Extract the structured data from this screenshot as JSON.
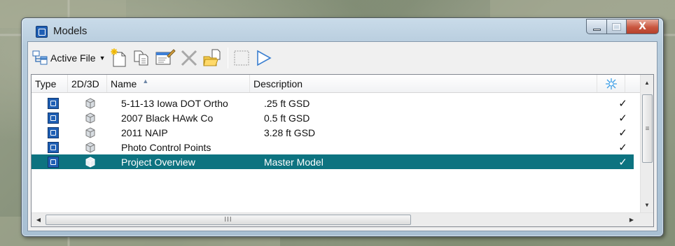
{
  "window": {
    "title": "Models"
  },
  "toolbar": {
    "active_file_label": "Active File",
    "icons": [
      "models-source-icon",
      "new-model-icon",
      "copy-model-icon",
      "model-properties-icon",
      "delete-icon",
      "import-icon",
      "select-all-icon",
      "open-model-icon"
    ]
  },
  "columns": {
    "type": "Type",
    "dim": "2D/3D",
    "name": "Name",
    "description": "Description",
    "display_icon": "display-toggle-icon"
  },
  "rows": [
    {
      "name": "5-11-13 Iowa DOT Ortho",
      "description": ".25 ft GSD",
      "check": "✓",
      "selected": false
    },
    {
      "name": "2007 Black HAwk Co",
      "description": "0.5 ft GSD",
      "check": "✓",
      "selected": false
    },
    {
      "name": "2011 NAIP",
      "description": "3.28 ft GSD",
      "check": "✓",
      "selected": false
    },
    {
      "name": "Photo Control Points",
      "description": "",
      "check": "✓",
      "selected": false
    },
    {
      "name": "Project Overview",
      "description": "Master Model",
      "check": "✓",
      "selected": true
    }
  ],
  "scroll": {
    "hthumb_glyph": "III",
    "vthumb_glyph": "≡"
  },
  "colors": {
    "selection": "#0d7380",
    "model_icon": "#1f5fb4"
  }
}
